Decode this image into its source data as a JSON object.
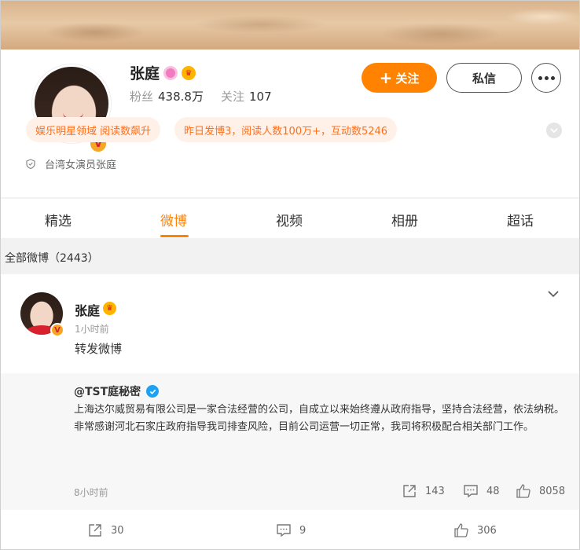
{
  "profile": {
    "name": "张庭",
    "followers_label": "粉丝",
    "followers_value": "438.8万",
    "following_label": "关注",
    "following_value": "107",
    "follow_button": "关注",
    "message_button": "私信",
    "tags": [
      "娱乐明星领域 阅读数飙升",
      "昨日发博3，阅读人数100万+，互动数5246"
    ],
    "description": "台湾女演员张庭"
  },
  "tabs": [
    {
      "label": "精选",
      "active": false
    },
    {
      "label": "微博",
      "active": true
    },
    {
      "label": "视频",
      "active": false
    },
    {
      "label": "相册",
      "active": false
    },
    {
      "label": "超话",
      "active": false
    }
  ],
  "feed": {
    "count_label": "全部微博（2443）"
  },
  "post": {
    "author": "张庭",
    "time": "1小时前",
    "text": "转发微博",
    "repost": {
      "author": "@TST庭秘密",
      "body_line1": "上海达尔威贸易有限公司是一家合法经营的公司，自成立以来始终遵从政府指导，坚持合法经营，依法纳税。",
      "body_line2": "非常感谢河北石家庄政府指导我司排查风险，目前公司运营一切正常，我司将积极配合相关部门工作。",
      "time": "8小时前",
      "shares": "143",
      "comments": "48",
      "likes": "8058"
    },
    "shares": "30",
    "comments": "9",
    "likes": "306"
  },
  "colors": {
    "accent": "#ff8200",
    "tag_bg": "#fff1e8",
    "tag_text": "#ff6f1a",
    "verified_blue": "#1da1f2"
  },
  "icons": {
    "avatar_badge": "gold-v-badge",
    "name_badges": [
      "pink-ring-icon",
      "gold-crown-icon"
    ],
    "share": "share-icon",
    "comment": "comment-icon",
    "like": "thumbs-up-icon"
  }
}
